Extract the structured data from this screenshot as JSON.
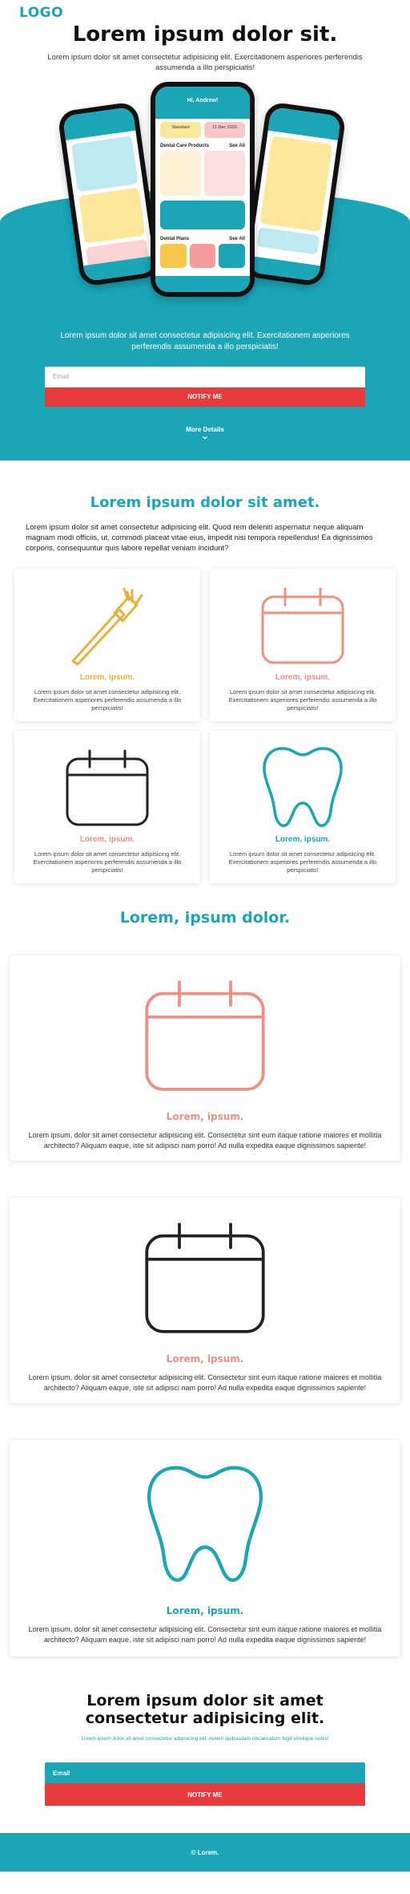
{
  "header": {
    "logo": "LOGO"
  },
  "hero": {
    "title": "Lorem ipsum dolor sit.",
    "subtitle": "Lorem ipsum dolor sit amet consectetur adipisicing elit. Exercitationem asperiores perferendis assumenda a illo perspiciatis!",
    "phone_center": {
      "greeting": "Hi, Andrew!",
      "badge_left": "Standard",
      "badge_right": "11 Dec 2020",
      "products_label": "Dental Care Products",
      "see_all": "See All",
      "plans_label": "Dental Plans"
    },
    "teal_text": "Lorem ipsum dolor sit amet consectetur adipisicing elit. Exercitationem asperiores perferendis assumenda a illo perspiciatis!",
    "email_placeholder": "Email",
    "notify_label": "NOTIFY ME",
    "more_details": "More Details"
  },
  "features": {
    "title": "Lorem ipsum dolor sit amet.",
    "intro": "Lorem ipsum dolor sit amet consectetur adipisicing elit. Quod rem deleniti aspernatur neque aliquam magnam modi officiis, ut, commodi placeat vitae eius, impedit nisi tempora repellendus! Ea dignissimos corporis, consequuntur quis labore repellat veniam incidunt?",
    "cards": [
      {
        "icon": "toothbrush-icon",
        "title": "Lorem, ipsum.",
        "text": "Lorem ipsum dolor sit amet consectetur adipisicing elit. Exercitationem asperiores perferendis assumenda a illo perspiciatis!",
        "color": "#e8b13a"
      },
      {
        "icon": "calendar-icon",
        "title": "Lorem, ipsum.",
        "text": "Lorem ipsum dolor sit amet consectetur adipisicing elit. Exercitationem asperiores perferendis assumenda a illo perspiciatis!",
        "color": "#ef8f84"
      },
      {
        "icon": "calendar-icon",
        "title": "Lorem, ipsum.",
        "text": "Lorem ipsum dolor sit amet consectetur adipisicing elit. Exercitationem asperiores perferendis assumenda a illo perspiciatis!",
        "color": "#ef8f84"
      },
      {
        "icon": "tooth-icon",
        "title": "Lorem, ipsum.",
        "text": "Lorem ipsum dolor sit amet consectetur adipisicing elit. Exercitationem asperiores perferendis assumenda a illo perspiciatis!",
        "color": "#1aa6b7"
      }
    ]
  },
  "details": {
    "title": "Lorem, ipsum dolor.",
    "cards": [
      {
        "icon": "calendar-icon",
        "title": "Lorem, ipsum.",
        "text": "Lorem ipsum, dolor sit amet consectetur adipisicing elit. Consectetur sint eum itaque ratione maiores et mollitia architecto? Aliquam eaque, iste sit adipisci nam porro! Ad nulla expedita eaque dignissimos sapiente!"
      },
      {
        "icon": "calendar-icon",
        "title": "Lorem, ipsum.",
        "text": "Lorem ipsum, dolor sit amet consectetur adipisicing elit. Consectetur sint eum itaque ratione maiores et mollitia architecto? Aliquam eaque, iste sit adipisci nam porro! Ad nulla expedita eaque dignissimos sapiente!"
      },
      {
        "icon": "tooth-icon",
        "title": "Lorem, ipsum.",
        "text": "Lorem ipsum, dolor sit amet consectetur adipisicing elit. Consectetur sint eum itaque ratione maiores et mollitia architecto? Aliquam eaque, iste sit adipisci nam porro! Ad nulla expedita eaque dignissimos sapiente!"
      }
    ]
  },
  "cta": {
    "title": "Lorem ipsum dolor sit amet consectetur adipisicing elit.",
    "subtitle": "Lorem ipsum dolor sit amet consectetur adipisicing elit. Autem quibusdam obcaecatum fugit similique nobis!",
    "email_placeholder": "Email",
    "notify_label": "NOTIFY ME"
  },
  "footer": {
    "text": "© Lorem."
  },
  "colors": {
    "accent": "#1aa6b7",
    "danger": "#e83a3a",
    "yellow": "#e8b13a",
    "salmon": "#ef8f84",
    "dark": "#222222"
  }
}
